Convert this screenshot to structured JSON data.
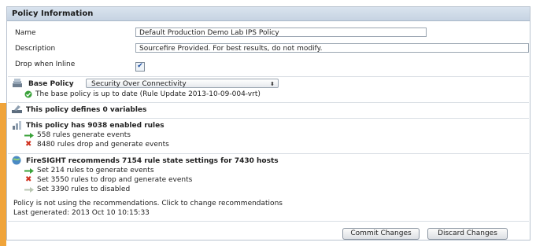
{
  "panel_title": "Policy Information",
  "fields": {
    "name_label": "Name",
    "name_value": "Default Production Demo Lab IPS Policy",
    "description_label": "Description",
    "description_value": "Sourcefire Provided. For best results, do not modify.",
    "drop_label": "Drop when Inline",
    "drop_checked": true
  },
  "base_policy": {
    "label": "Base Policy",
    "selected": "Security Over Connectivity",
    "status": "The base policy is up to date (Rule Update 2013-10-09-004-vrt)"
  },
  "variables": {
    "title": "This policy defines 0 variables"
  },
  "rules": {
    "title": "This policy has 9038 enabled rules",
    "generate": "558 rules generate events",
    "drop": "8480 rules drop and generate events"
  },
  "firesight": {
    "title": "FireSIGHT recommends 7154 rule state settings for 7430 hosts",
    "set_generate": "Set 214 rules to generate events",
    "set_drop": "Set 3550 rules to drop and generate events",
    "set_disabled": "Set 3390 rules to disabled"
  },
  "footer": {
    "notice": "Policy is not using the recommendations. Click to change recommendations",
    "last_generated": "Last generated: 2013 Oct 10 10:15:33"
  },
  "buttons": {
    "commit": "Commit Changes",
    "discard": "Discard Changes"
  },
  "colors": {
    "header_bg": "#c6d3e2",
    "accent_orange": "#f0a43a",
    "green": "#3aa23a",
    "red": "#d0311f"
  }
}
